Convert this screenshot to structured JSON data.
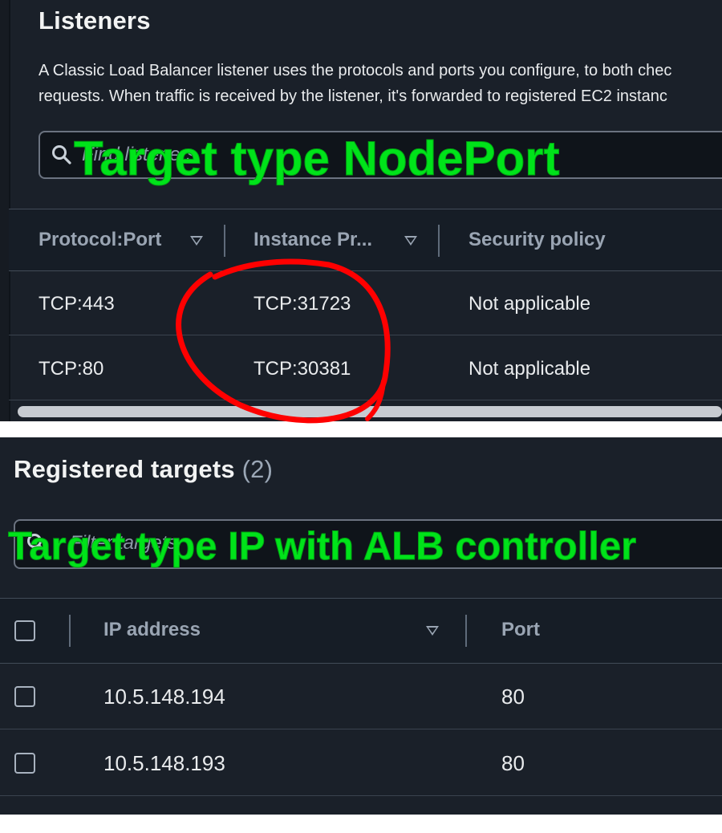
{
  "listeners": {
    "title": "Listeners",
    "description_line1": "A Classic Load Balancer listener uses the protocols and ports you configure, to both chec",
    "description_line2": "requests. When traffic is received by the listener, it's forwarded to registered EC2 instanc",
    "search_placeholder": "Find listeners",
    "overlay_label": "Target type NodePort",
    "columns": [
      "Protocol:Port",
      "Instance Pr...",
      "Security policy"
    ],
    "rows": [
      {
        "protocol_port": "TCP:443",
        "instance_protocol": "TCP:31723",
        "security_policy": "Not applicable"
      },
      {
        "protocol_port": "TCP:80",
        "instance_protocol": "TCP:30381",
        "security_policy": "Not applicable"
      }
    ]
  },
  "registered_targets": {
    "title": "Registered targets",
    "count": "(2)",
    "search_placeholder": "Filter targets",
    "overlay_label": "Target type IP with ALB controller",
    "columns": [
      "IP address",
      "Port"
    ],
    "rows": [
      {
        "ip": "10.5.148.194",
        "port": "80"
      },
      {
        "ip": "10.5.148.193",
        "port": "80"
      }
    ]
  },
  "colors": {
    "panel_bg": "#1a2029",
    "overlay_green": "#00e31a",
    "annotation_red": "#ff0000"
  }
}
